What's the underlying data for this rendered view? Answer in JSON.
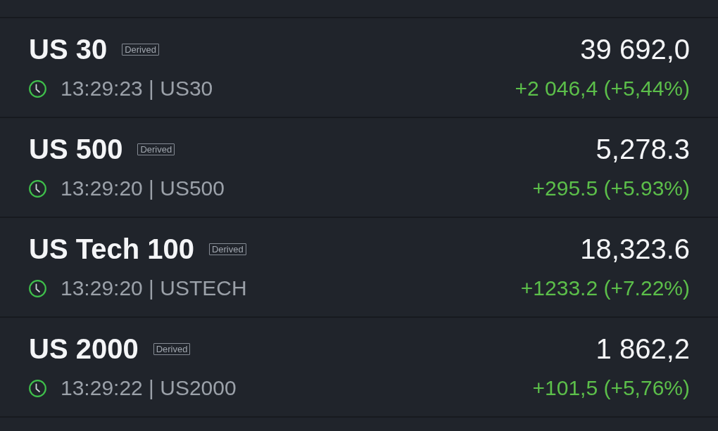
{
  "instruments": [
    {
      "name": "US 30",
      "tag": "Derived",
      "meta": "13:29:23 | US30",
      "price": "39 692,0",
      "change": "+2 046,4 (+5,44%)",
      "positive": true
    },
    {
      "name": "US 500",
      "tag": "Derived",
      "meta": "13:29:20 | US500",
      "price": "5,278.3",
      "change": "+295.5 (+5.93%)",
      "positive": true
    },
    {
      "name": "US Tech 100",
      "tag": "Derived",
      "meta": "13:29:20 | USTECH",
      "price": "18,323.6",
      "change": "+1233.2 (+7.22%)",
      "positive": true
    },
    {
      "name": "US 2000",
      "tag": "Derived",
      "meta": "13:29:22 | US2000",
      "price": "1 862,2",
      "change": "+101,5 (+5,76%)",
      "positive": true
    }
  ]
}
